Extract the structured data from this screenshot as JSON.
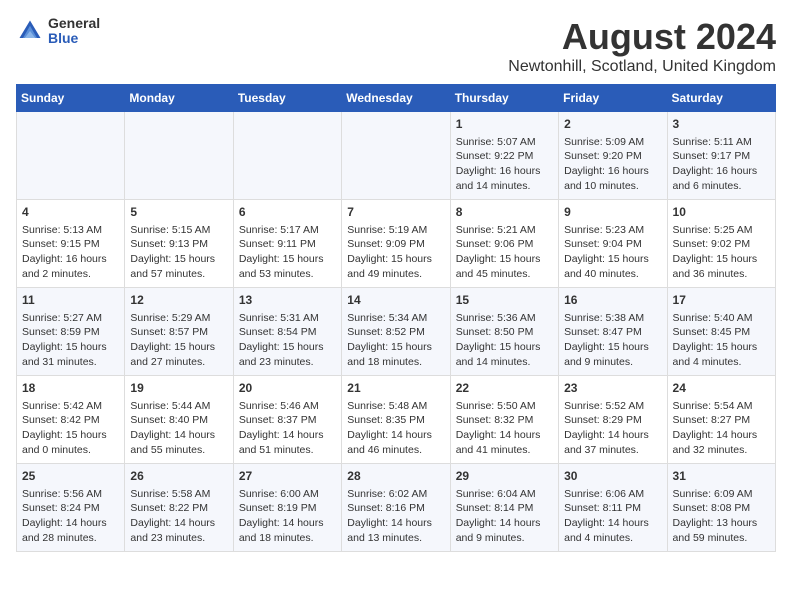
{
  "header": {
    "logo_general": "General",
    "logo_blue": "Blue",
    "title": "August 2024",
    "subtitle": "Newtonhill, Scotland, United Kingdom"
  },
  "days_of_week": [
    "Sunday",
    "Monday",
    "Tuesday",
    "Wednesday",
    "Thursday",
    "Friday",
    "Saturday"
  ],
  "weeks": [
    {
      "cells": [
        {
          "day": "",
          "content": ""
        },
        {
          "day": "",
          "content": ""
        },
        {
          "day": "",
          "content": ""
        },
        {
          "day": "",
          "content": ""
        },
        {
          "day": "1",
          "content": "Sunrise: 5:07 AM\nSunset: 9:22 PM\nDaylight: 16 hours\nand 14 minutes."
        },
        {
          "day": "2",
          "content": "Sunrise: 5:09 AM\nSunset: 9:20 PM\nDaylight: 16 hours\nand 10 minutes."
        },
        {
          "day": "3",
          "content": "Sunrise: 5:11 AM\nSunset: 9:17 PM\nDaylight: 16 hours\nand 6 minutes."
        }
      ]
    },
    {
      "cells": [
        {
          "day": "4",
          "content": "Sunrise: 5:13 AM\nSunset: 9:15 PM\nDaylight: 16 hours\nand 2 minutes."
        },
        {
          "day": "5",
          "content": "Sunrise: 5:15 AM\nSunset: 9:13 PM\nDaylight: 15 hours\nand 57 minutes."
        },
        {
          "day": "6",
          "content": "Sunrise: 5:17 AM\nSunset: 9:11 PM\nDaylight: 15 hours\nand 53 minutes."
        },
        {
          "day": "7",
          "content": "Sunrise: 5:19 AM\nSunset: 9:09 PM\nDaylight: 15 hours\nand 49 minutes."
        },
        {
          "day": "8",
          "content": "Sunrise: 5:21 AM\nSunset: 9:06 PM\nDaylight: 15 hours\nand 45 minutes."
        },
        {
          "day": "9",
          "content": "Sunrise: 5:23 AM\nSunset: 9:04 PM\nDaylight: 15 hours\nand 40 minutes."
        },
        {
          "day": "10",
          "content": "Sunrise: 5:25 AM\nSunset: 9:02 PM\nDaylight: 15 hours\nand 36 minutes."
        }
      ]
    },
    {
      "cells": [
        {
          "day": "11",
          "content": "Sunrise: 5:27 AM\nSunset: 8:59 PM\nDaylight: 15 hours\nand 31 minutes."
        },
        {
          "day": "12",
          "content": "Sunrise: 5:29 AM\nSunset: 8:57 PM\nDaylight: 15 hours\nand 27 minutes."
        },
        {
          "day": "13",
          "content": "Sunrise: 5:31 AM\nSunset: 8:54 PM\nDaylight: 15 hours\nand 23 minutes."
        },
        {
          "day": "14",
          "content": "Sunrise: 5:34 AM\nSunset: 8:52 PM\nDaylight: 15 hours\nand 18 minutes."
        },
        {
          "day": "15",
          "content": "Sunrise: 5:36 AM\nSunset: 8:50 PM\nDaylight: 15 hours\nand 14 minutes."
        },
        {
          "day": "16",
          "content": "Sunrise: 5:38 AM\nSunset: 8:47 PM\nDaylight: 15 hours\nand 9 minutes."
        },
        {
          "day": "17",
          "content": "Sunrise: 5:40 AM\nSunset: 8:45 PM\nDaylight: 15 hours\nand 4 minutes."
        }
      ]
    },
    {
      "cells": [
        {
          "day": "18",
          "content": "Sunrise: 5:42 AM\nSunset: 8:42 PM\nDaylight: 15 hours\nand 0 minutes."
        },
        {
          "day": "19",
          "content": "Sunrise: 5:44 AM\nSunset: 8:40 PM\nDaylight: 14 hours\nand 55 minutes."
        },
        {
          "day": "20",
          "content": "Sunrise: 5:46 AM\nSunset: 8:37 PM\nDaylight: 14 hours\nand 51 minutes."
        },
        {
          "day": "21",
          "content": "Sunrise: 5:48 AM\nSunset: 8:35 PM\nDaylight: 14 hours\nand 46 minutes."
        },
        {
          "day": "22",
          "content": "Sunrise: 5:50 AM\nSunset: 8:32 PM\nDaylight: 14 hours\nand 41 minutes."
        },
        {
          "day": "23",
          "content": "Sunrise: 5:52 AM\nSunset: 8:29 PM\nDaylight: 14 hours\nand 37 minutes."
        },
        {
          "day": "24",
          "content": "Sunrise: 5:54 AM\nSunset: 8:27 PM\nDaylight: 14 hours\nand 32 minutes."
        }
      ]
    },
    {
      "cells": [
        {
          "day": "25",
          "content": "Sunrise: 5:56 AM\nSunset: 8:24 PM\nDaylight: 14 hours\nand 28 minutes."
        },
        {
          "day": "26",
          "content": "Sunrise: 5:58 AM\nSunset: 8:22 PM\nDaylight: 14 hours\nand 23 minutes."
        },
        {
          "day": "27",
          "content": "Sunrise: 6:00 AM\nSunset: 8:19 PM\nDaylight: 14 hours\nand 18 minutes."
        },
        {
          "day": "28",
          "content": "Sunrise: 6:02 AM\nSunset: 8:16 PM\nDaylight: 14 hours\nand 13 minutes."
        },
        {
          "day": "29",
          "content": "Sunrise: 6:04 AM\nSunset: 8:14 PM\nDaylight: 14 hours\nand 9 minutes."
        },
        {
          "day": "30",
          "content": "Sunrise: 6:06 AM\nSunset: 8:11 PM\nDaylight: 14 hours\nand 4 minutes."
        },
        {
          "day": "31",
          "content": "Sunrise: 6:09 AM\nSunset: 8:08 PM\nDaylight: 13 hours\nand 59 minutes."
        }
      ]
    }
  ]
}
